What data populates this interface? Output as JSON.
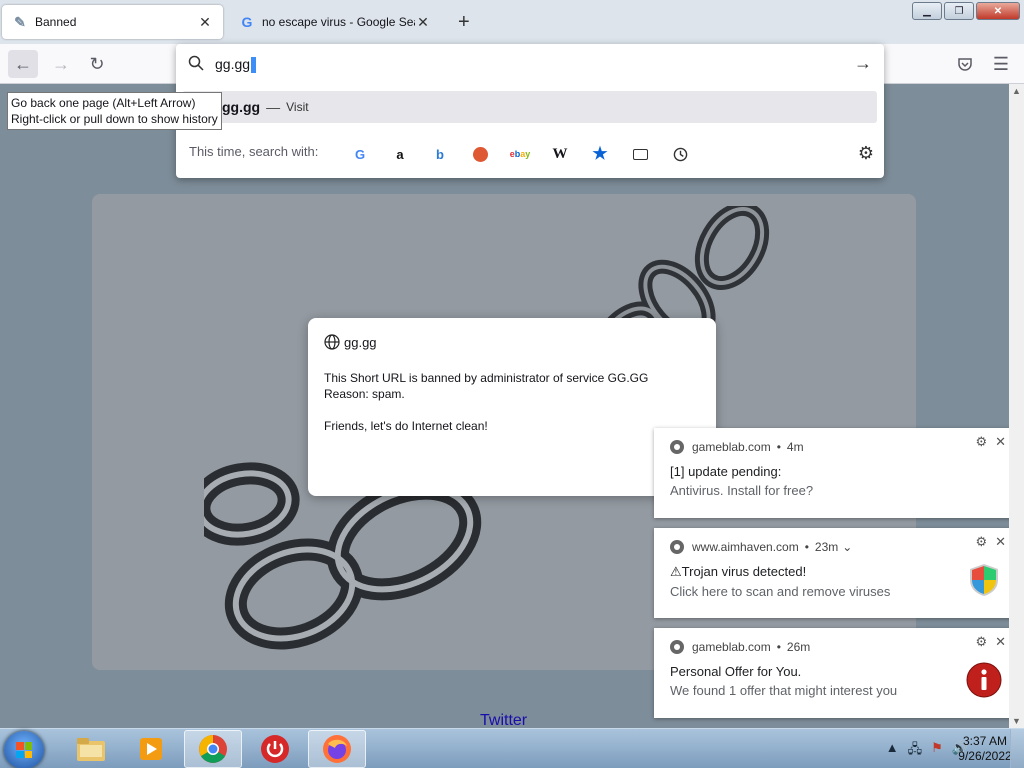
{
  "browser": {
    "tabs": [
      {
        "title": "Banned",
        "close": "✕"
      },
      {
        "title": "no escape virus - Google Search",
        "close": "✕"
      }
    ],
    "new_tab": "+",
    "url_value": "gg.gg",
    "suggestion": {
      "host": "gg.gg",
      "separator": "—",
      "action": "Visit"
    },
    "search_with_label": "This time, search with:",
    "engines": [
      "Google",
      "Amazon",
      "Bing",
      "DuckDuckGo",
      "eBay",
      "Wikipedia",
      "Bookmarks",
      "Tabs",
      "History"
    ],
    "tooltip": {
      "line1": "Go back one page (Alt+Left Arrow)",
      "line2": "Right-click or pull down to show history"
    }
  },
  "dialog": {
    "origin": "gg.gg",
    "line1": "This Short URL is banned by administrator of service GG.GG",
    "line2": "Reason: spam.",
    "line3": "Friends, let's do Internet clean!"
  },
  "page": {
    "twitter_link": "Twitter"
  },
  "notifications": [
    {
      "source": "gameblab.com",
      "time": "4m",
      "title": "[1] update pending:",
      "body": "Antivirus. Install for free?",
      "expand": ""
    },
    {
      "source": "www.aimhaven.com",
      "time": "23m",
      "title": "⚠Trojan virus detected!",
      "body": "Click here to scan and remove viruses",
      "expand": "⌄"
    },
    {
      "source": "gameblab.com",
      "time": "26m",
      "title": "Personal Offer for You.",
      "body": "We found 1 offer that might interest you",
      "expand": ""
    }
  ],
  "taskbar": {
    "time": "3:37 AM",
    "date": "9/26/2022"
  },
  "colors": {
    "page_bg": "#7d8d99",
    "accent_blue": "#3d8ef5",
    "link": "#1a0dab"
  }
}
